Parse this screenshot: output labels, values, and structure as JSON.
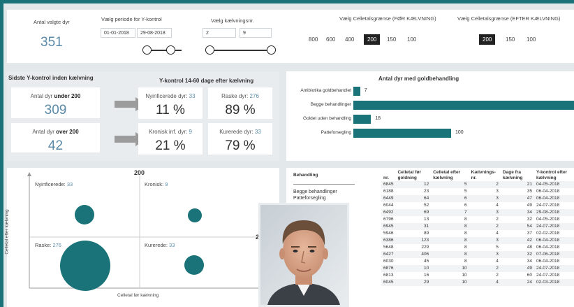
{
  "top": {
    "antal_label": "Antal valgte dyr",
    "antal_value": "351",
    "periode_label": "Vælg periode for Y-kontrol",
    "date_from": "01-01-2018",
    "date_to": "29-08-2018",
    "kaelvning_label": "Vælg kælvningsnr.",
    "kaelv_from": "2",
    "kaelv_to": "9",
    "celle_foer_label": "Vælg Celletalsgrænse (FØR KÆLVNING)",
    "celle_foer_options": [
      "800",
      "600",
      "400",
      "200",
      "150",
      "100"
    ],
    "celle_foer_selected": "200",
    "celle_efter_label": "Vælg Celletalsgrænse (EFTER KÆLVNING)",
    "celle_efter_options": [
      "200",
      "150",
      "100"
    ],
    "celle_efter_selected": "200"
  },
  "ykontrol": {
    "left_title": "Sidste Y-kontrol inden kælvning",
    "right_title": "Y-kontrol 14-60 dage efter kælvning",
    "under_prefix": "Antal dyr",
    "under_bold": "under",
    "under_limit": "200",
    "under_value": "309",
    "over_prefix": "Antal dyr",
    "over_bold": "over",
    "over_limit": "200",
    "over_value": "42",
    "nyinf_label": "Nyinficerede dyr:",
    "nyinf_count": "33",
    "nyinf_pct": "11 %",
    "raske_label": "Raske dyr:",
    "raske_count": "276",
    "raske_pct": "89 %",
    "kronisk_label": "Kronisk inf. dyr:",
    "kronisk_count": "9",
    "kronisk_pct": "21 %",
    "kurerede_label": "Kurerede dyr:",
    "kurerede_count": "33",
    "kurerede_pct": "79 %"
  },
  "chart_data": {
    "type": "bar",
    "title": "Antal dyr med goldbehandling",
    "categories": [
      "Antibiotika goldbehandlet",
      "Begge behandlinger",
      "Goldet uden behandling",
      "Patteforsegling"
    ],
    "values": [
      7,
      null,
      18,
      100
    ]
  },
  "quadrant": {
    "center_label": "200",
    "right_label": "2",
    "ylabel": "Celletal efter kælvning",
    "xlabel": "Celletal før kælvning",
    "q_nyinf_label": "Nyinficerede:",
    "q_nyinf_val": "33",
    "q_kronisk_label": "Kronisk:",
    "q_kronisk_val": "9",
    "q_raske_label": "Raske:",
    "q_raske_val": "276",
    "q_kurerede_label": "Kurerede:",
    "q_kurerede_val": "33"
  },
  "table": {
    "behandling_header": "Behandling",
    "behandling_rows": [
      "Begge behandlinger",
      "Patteforsegling"
    ],
    "headers": [
      "nr.",
      "Celletal før goldning",
      "Celletal efter kælvning",
      "Kælvnings-nr.",
      "Dage fra kælvning",
      "Y-kontrol efter kælvning"
    ],
    "rows": [
      [
        "6845",
        "12",
        "5",
        "2",
        "21",
        "04-05-2018"
      ],
      [
        "6188",
        "23",
        "5",
        "3",
        "35",
        "06-04-2018"
      ],
      [
        "6449",
        "64",
        "6",
        "3",
        "47",
        "06-04-2018"
      ],
      [
        "6044",
        "52",
        "6",
        "4",
        "49",
        "24-07-2018"
      ],
      [
        "6492",
        "69",
        "7",
        "3",
        "34",
        "29-08-2018"
      ],
      [
        "6796",
        "13",
        "8",
        "2",
        "32",
        "04-05-2018"
      ],
      [
        "6945",
        "31",
        "8",
        "2",
        "54",
        "24-07-2018"
      ],
      [
        "5946",
        "89",
        "8",
        "4",
        "37",
        "02-02-2018"
      ],
      [
        "6386",
        "123",
        "8",
        "3",
        "42",
        "06-04-2018"
      ],
      [
        "5648",
        "229",
        "8",
        "5",
        "48",
        "06-04-2018"
      ],
      [
        "6427",
        "406",
        "8",
        "3",
        "32",
        "07-06-2018"
      ],
      [
        "6030",
        "45",
        "8",
        "4",
        "34",
        "06-04-2018"
      ],
      [
        "6876",
        "10",
        "10",
        "2",
        "49",
        "24-07-2018"
      ],
      [
        "6813",
        "16",
        "10",
        "2",
        "60",
        "24-07-2018"
      ],
      [
        "6045",
        "29",
        "10",
        "4",
        "24",
        "02-03-2018"
      ]
    ]
  },
  "colors": {
    "teal": "#1a7378",
    "number_blue": "#5b8aa8",
    "background": "#e3e8eb"
  }
}
